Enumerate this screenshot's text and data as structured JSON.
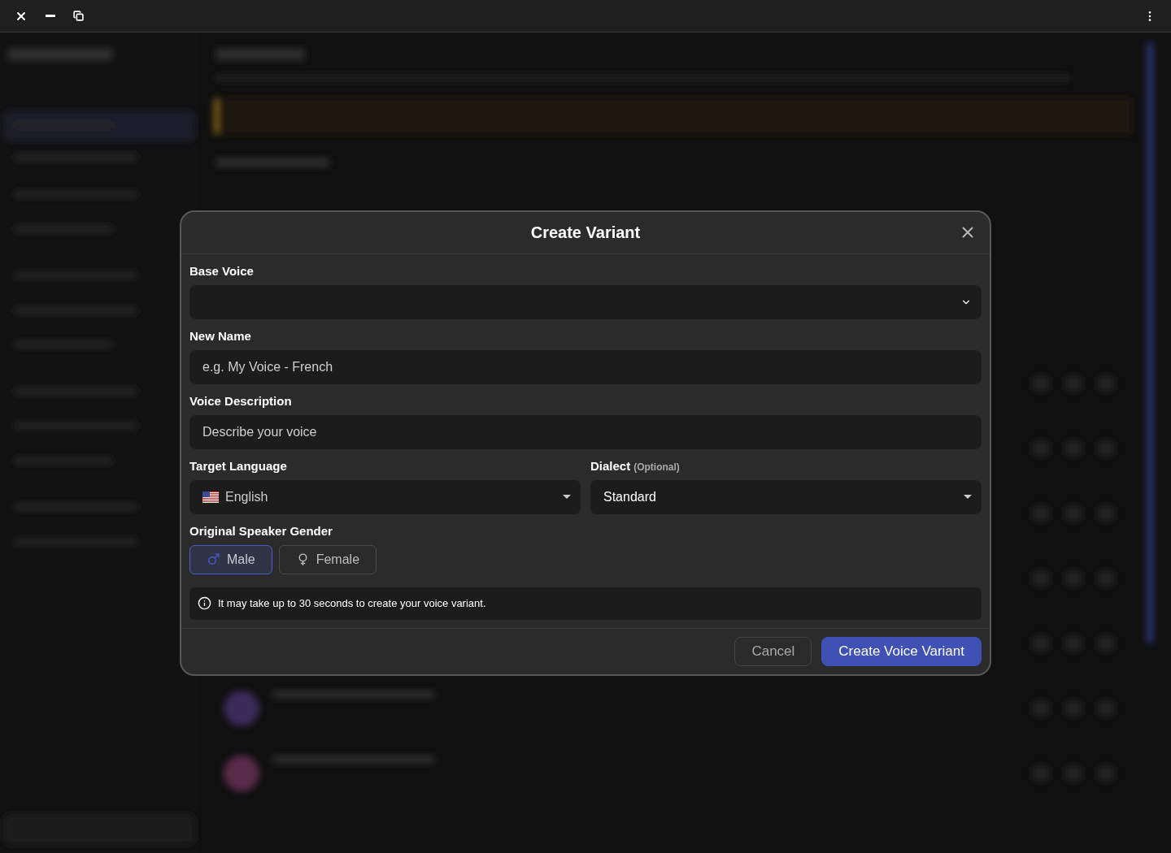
{
  "dialog": {
    "title": "Create Variant",
    "base_voice": {
      "label": "Base Voice"
    },
    "new_name": {
      "label": "New Name",
      "placeholder": "e.g. My Voice - French"
    },
    "voice_description": {
      "label": "Voice Description",
      "placeholder": "Describe your voice"
    },
    "target_language": {
      "label": "Target Language",
      "value": "English"
    },
    "dialect": {
      "label": "Dialect",
      "hint": "(Optional)",
      "value": "Standard"
    },
    "gender": {
      "label": "Original Speaker Gender",
      "options": [
        {
          "label": "Male",
          "kind": "male",
          "selected": true
        },
        {
          "label": "Female",
          "kind": "female",
          "selected": false
        }
      ]
    },
    "notice": "It may take up to 30 seconds to create your voice variant.",
    "buttons": [
      {
        "label": "Cancel",
        "kind": "secondary"
      },
      {
        "label": "Create Voice Variant",
        "kind": "primary"
      }
    ]
  }
}
